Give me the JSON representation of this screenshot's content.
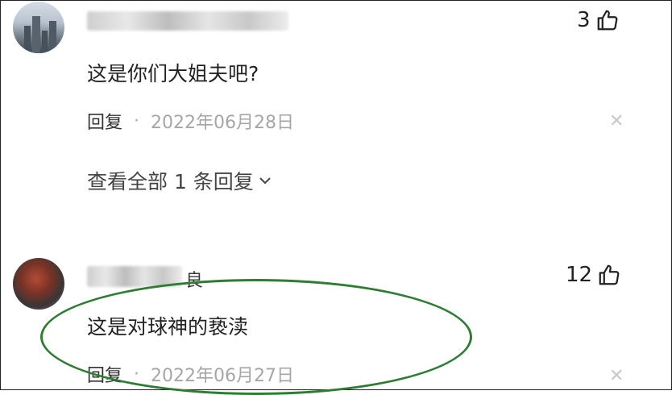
{
  "comments": [
    {
      "author_visible_tail": "",
      "text": "这是你们大姐夫吧?",
      "likes": "3",
      "reply_label": "回复",
      "separator": "·",
      "date": "2022年06月28日",
      "view_replies_label": "查看全部 1 条回复"
    },
    {
      "author_visible_tail": "良",
      "text": "这是对球神的亵渎",
      "likes": "12",
      "reply_label": "回复",
      "separator": "·",
      "date": "2022年06月27日"
    }
  ],
  "icons": {
    "like": "thumbs-up-icon",
    "close": "close-icon",
    "expand": "chevron-down-icon"
  },
  "colors": {
    "annotation_ellipse": "#2e7d32",
    "date_text": "#a6a6a6",
    "close_icon": "#c8c8c8"
  }
}
